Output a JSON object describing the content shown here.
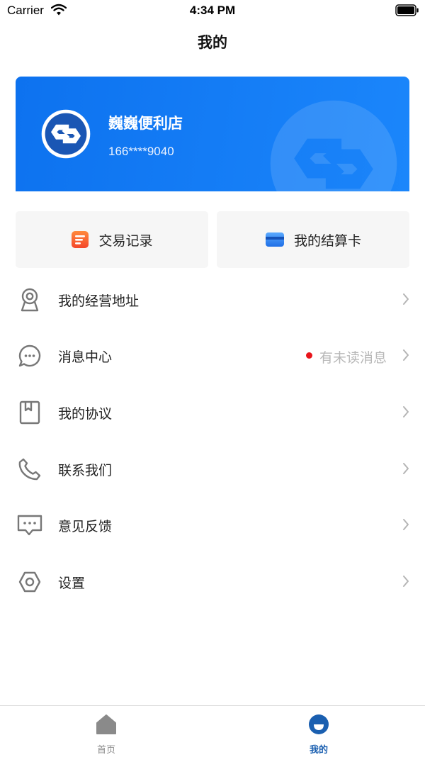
{
  "status_bar": {
    "carrier": "Carrier",
    "time": "4:34 PM"
  },
  "nav": {
    "title": "我的"
  },
  "profile": {
    "store_name": "巍巍便利店",
    "phone": "166****9040"
  },
  "quick_actions": [
    {
      "label": "交易记录",
      "icon": "transaction-record-icon"
    },
    {
      "label": "我的结算卡",
      "icon": "settlement-card-icon"
    }
  ],
  "menu": [
    {
      "label": "我的经营地址",
      "icon": "location-icon"
    },
    {
      "label": "消息中心",
      "icon": "message-icon",
      "badge": "有未读消息"
    },
    {
      "label": "我的协议",
      "icon": "agreement-icon"
    },
    {
      "label": "联系我们",
      "icon": "phone-icon"
    },
    {
      "label": "意见反馈",
      "icon": "feedback-icon"
    },
    {
      "label": "设置",
      "icon": "settings-icon"
    }
  ],
  "tabs": [
    {
      "label": "首页",
      "icon": "home-icon",
      "active": false
    },
    {
      "label": "我的",
      "icon": "profile-icon",
      "active": true
    }
  ],
  "colors": {
    "brand_blue": "#1681f8",
    "active_tab": "#1a5fb0",
    "inactive_tab": "#8a8a8a",
    "unread_dot": "#e8151b"
  }
}
